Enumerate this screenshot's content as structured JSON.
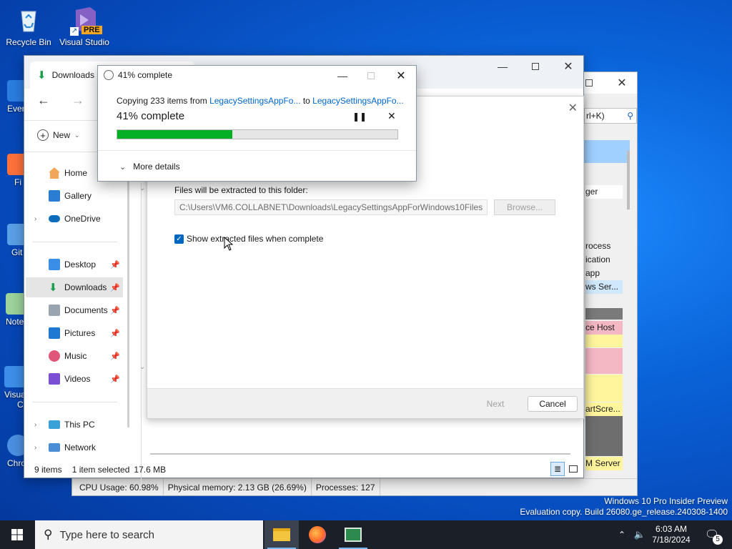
{
  "desktop": {
    "icons": [
      {
        "label": "Recycle Bin",
        "icon": "recycle-bin-icon"
      },
      {
        "label": "Visual Studio",
        "icon": "visual-studio-icon",
        "badge": "PRE"
      }
    ],
    "partial_icons": [
      "Ever",
      "Fi",
      "Git",
      "Note",
      "Visua",
      "C",
      "Chro"
    ],
    "watermark_line1": "Windows 10 Pro Insider Preview",
    "watermark_line2": "Evaluation copy. Build 26080.ge_release.240308-1400"
  },
  "task_manager": {
    "search_hint": "rl+K)",
    "rows": [
      "ger",
      "rocess",
      "ication",
      "app",
      "ws Ser...",
      "ce Host",
      "artScre...",
      "M Server"
    ],
    "status": {
      "cpu": "CPU Usage: 60.98%",
      "memory": "Physical memory: 2.13 GB (26.69%)",
      "processes": "Processes: 127"
    }
  },
  "explorer": {
    "tab_title": "Downloads",
    "new_label": "New",
    "nav": {
      "home": "Home",
      "gallery": "Gallery",
      "onedrive": "OneDrive",
      "desktop": "Desktop",
      "downloads": "Downloads",
      "documents": "Documents",
      "pictures": "Pictures",
      "music": "Music",
      "videos": "Videos",
      "this_pc": "This PC",
      "network": "Network"
    },
    "status": {
      "items": "9 items",
      "selected": "1 item selected",
      "size": "17.6 MB"
    }
  },
  "wizard": {
    "folder_label": "Files will be extracted to this folder:",
    "folder_path": "C:\\Users\\VM6.COLLABNET\\Downloads\\LegacySettingsAppForWindows10Files",
    "browse_label": "Browse...",
    "show_files_label": "Show extracted files when complete",
    "show_files_checked": true,
    "next_label": "Next",
    "cancel_label": "Cancel"
  },
  "progress": {
    "title": "41% complete",
    "copying_prefix": "Copying 233 items from ",
    "source": "LegacySettingsAppFo...",
    "to_word": " to ",
    "destination": "LegacySettingsAppFo...",
    "status": "41% complete",
    "percent": 41,
    "more_details": "More details"
  },
  "taskbar": {
    "search_placeholder": "Type here to search",
    "time": "6:03 AM",
    "date": "7/18/2024",
    "notification_count": "5"
  },
  "colors": {
    "progress_fill": "#06b025",
    "accent": "#0067c0",
    "link": "#0066cc"
  }
}
